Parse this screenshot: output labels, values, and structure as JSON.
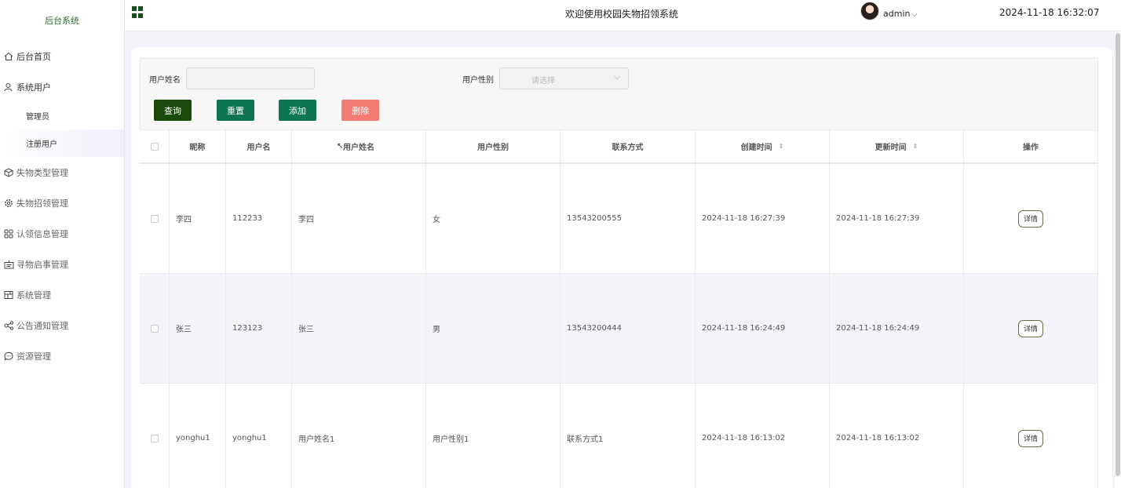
{
  "sidebar": {
    "brand": "后台系统",
    "items": [
      {
        "label": "后台首页",
        "icon": "home-icon"
      },
      {
        "label": "系统用户",
        "icon": "user-icon"
      },
      {
        "label": "管理员",
        "sub": true
      },
      {
        "label": "注册用户",
        "sub": true,
        "active": true
      },
      {
        "label": "失物类型管理",
        "icon": "cube-icon"
      },
      {
        "label": "失物招领管理",
        "icon": "gear-icon"
      },
      {
        "label": "认领信息管理",
        "icon": "grid-icon"
      },
      {
        "label": "寻物启事管理",
        "icon": "notice-icon"
      },
      {
        "label": "系统管理",
        "icon": "layout-icon"
      },
      {
        "label": "公告通知管理",
        "icon": "share-icon"
      },
      {
        "label": "资源管理",
        "icon": "chat-icon"
      }
    ]
  },
  "topbar": {
    "title": "欢迎使用校园失物招领系统",
    "username": "admin",
    "datetime": "2024-11-18 16:32:07"
  },
  "search": {
    "name_label": "用户姓名",
    "name_value": "",
    "gender_label": "用户性别",
    "gender_placeholder": "请选择",
    "buttons": {
      "query": "查询",
      "reset": "重置",
      "add": "添加",
      "delete": "删除"
    },
    "colors": {
      "query": "#1a4a0c",
      "reset": "#0e7554",
      "add": "#0e7554",
      "delete": "#f47b72"
    }
  },
  "table": {
    "headers": [
      "昵称",
      "用户名",
      "用户姓名",
      "用户性别",
      "联系方式",
      "创建时间",
      "更新时间",
      "操作"
    ],
    "rows": [
      {
        "nickname": "李四",
        "username": "112233",
        "name": "李四",
        "gender": "女",
        "phone": "13543200555",
        "created": "2024-11-18 16:27:39",
        "updated": "2024-11-18 16:27:39",
        "action": "详情"
      },
      {
        "nickname": "张三",
        "username": "123123",
        "name": "张三",
        "gender": "男",
        "phone": "13543200444",
        "created": "2024-11-18 16:24:49",
        "updated": "2024-11-18 16:24:49",
        "action": "详情"
      },
      {
        "nickname": "yonghu1",
        "username": "yonghu1",
        "name": "用户姓名1",
        "gender": "用户性别1",
        "phone": "联系方式1",
        "created": "2024-11-18 16:13:02",
        "updated": "2024-11-18 16:13:02",
        "action": "详情"
      }
    ]
  }
}
